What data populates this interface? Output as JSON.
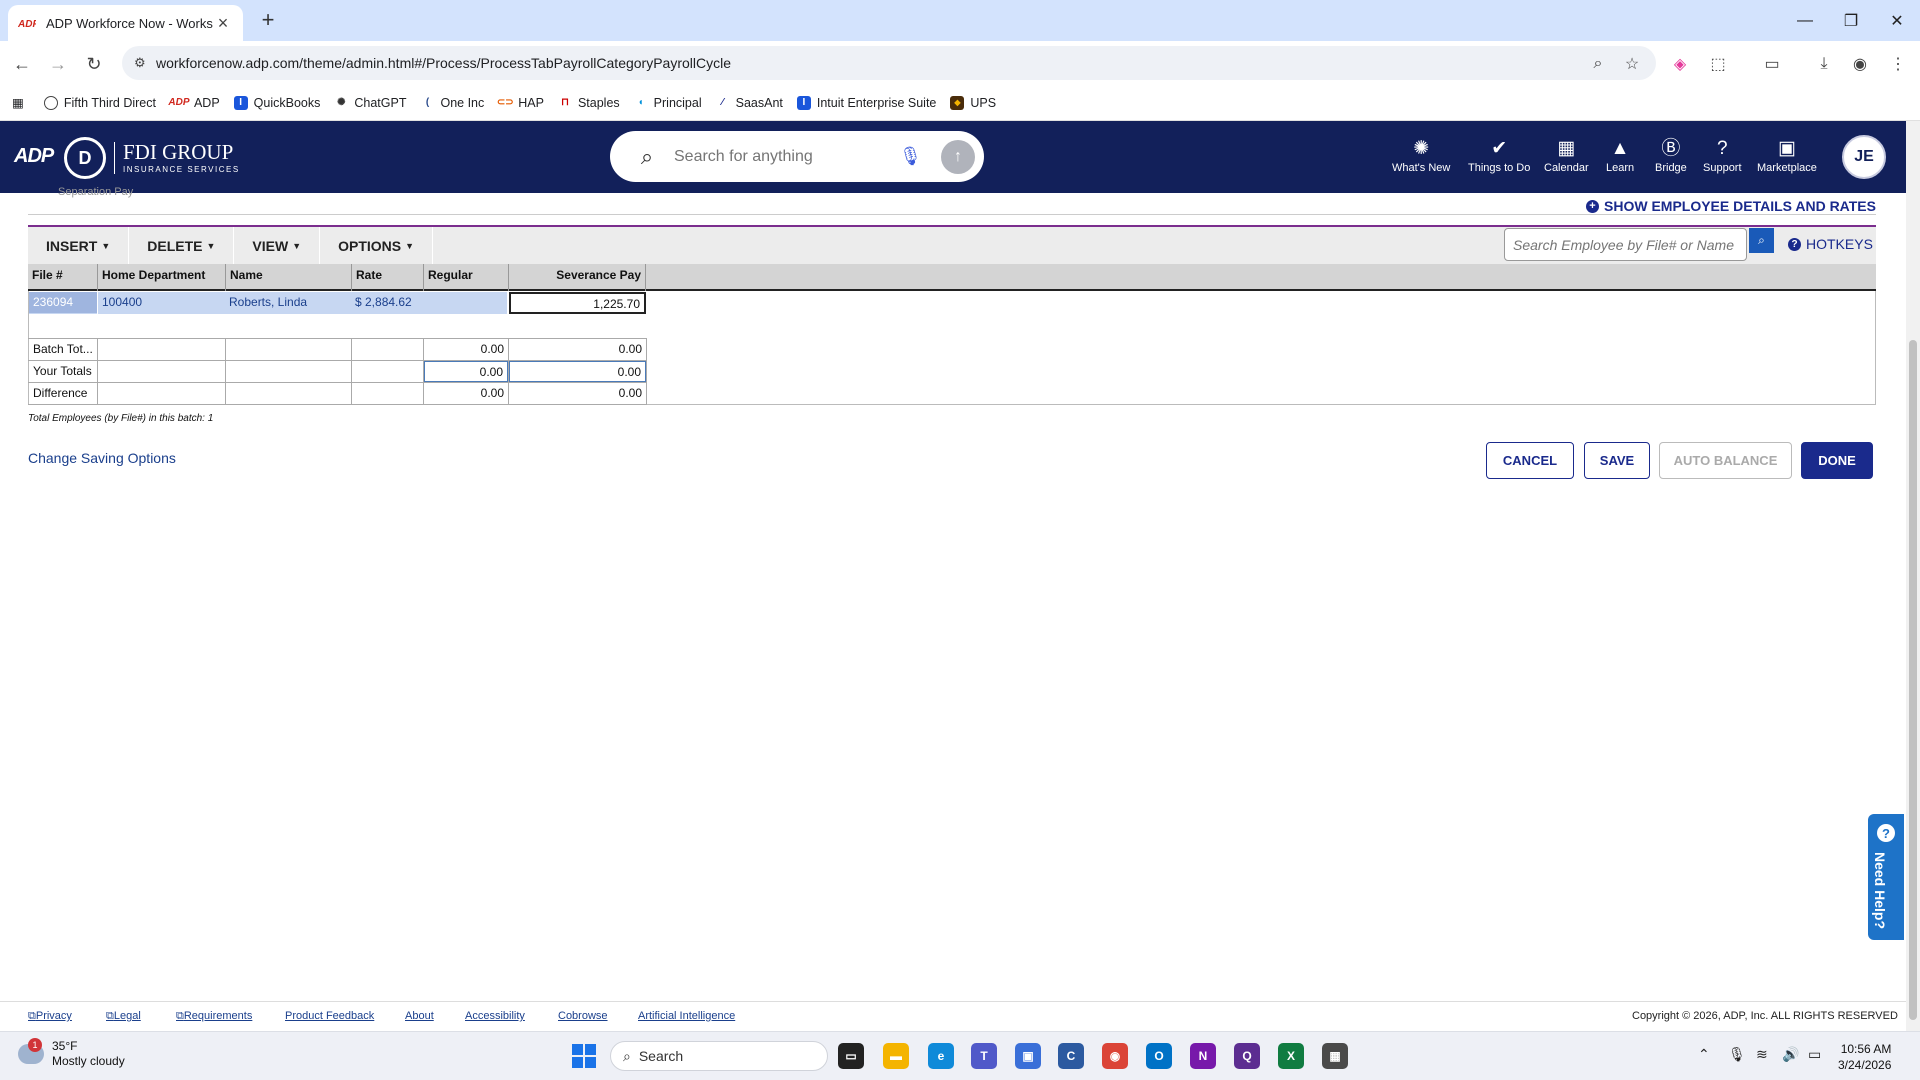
{
  "browser": {
    "tab_title": "ADP Workforce Now - Workshe",
    "url": "workforcenow.adp.com/theme/admin.html#/Process/ProcessTabPayrollCategoryPayrollCycle",
    "bookmarks": [
      "Fifth Third Direct",
      "ADP",
      "QuickBooks",
      "ChatGPT",
      "One Inc",
      "HAP",
      "Staples",
      "Principal",
      "SaasAnt",
      "Intuit Enterprise Suite",
      "UPS"
    ]
  },
  "header": {
    "adp_logo": "ADP",
    "brand_name": "FDI GROUP",
    "brand_sub": "INSURANCE SERVICES",
    "search_placeholder": "Search for anything",
    "nav": [
      {
        "label": "What's New",
        "icon": "lightbulb-icon"
      },
      {
        "label": "Things to Do",
        "icon": "check-circle-icon"
      },
      {
        "label": "Calendar",
        "icon": "calendar-icon"
      },
      {
        "label": "Learn",
        "icon": "graduation-cap-icon"
      },
      {
        "label": "Bridge",
        "icon": "bridge-icon"
      },
      {
        "label": "Support",
        "icon": "question-icon"
      },
      {
        "label": "Marketplace",
        "icon": "bag-icon"
      }
    ],
    "avatar_initials": "JE"
  },
  "page": {
    "partial_text": "Separation Pay",
    "show_details": "SHOW EMPLOYEE DETAILS AND RATES",
    "menus": [
      "INSERT",
      "DELETE",
      "VIEW",
      "OPTIONS"
    ],
    "employee_search_placeholder": "Search Employee by File# or Name",
    "hotkeys": "HOTKEYS",
    "columns": [
      "File #",
      "Home Department",
      "Name",
      "Rate",
      "Regular Hours",
      "Severance Pay"
    ],
    "row": {
      "file": "236094",
      "dept": "100400",
      "name": "Roberts, Linda",
      "rate": "$ 2,884.62",
      "hours": "",
      "severance": "1,225.70"
    },
    "totals": [
      {
        "label": "Batch Tot...",
        "hours": "0.00",
        "severance": "0.00"
      },
      {
        "label": "Your Totals",
        "hours": "0.00",
        "severance": "0.00"
      },
      {
        "label": "Difference",
        "hours": "0.00",
        "severance": "0.00"
      }
    ],
    "footnote": "Total Employees (by File#) in this batch: 1",
    "change_saving": "Change Saving Options",
    "buttons": {
      "cancel": "CANCEL",
      "save": "SAVE",
      "auto_balance": "AUTO BALANCE",
      "done": "DONE"
    },
    "need_help": "Need Help?"
  },
  "footer": {
    "links": [
      "Privacy",
      "Legal",
      "Requirements",
      "Product Feedback",
      "About",
      "Accessibility",
      "Cobrowse",
      "Artificial Intelligence"
    ],
    "copyright": "Copyright © 2026, ADP, Inc. ALL RIGHTS RESERVED"
  },
  "taskbar": {
    "temp": "35°F",
    "weather": "Mostly cloudy",
    "weather_badge": "1",
    "search": "Search",
    "time": "10:56 AM",
    "date": "3/24/2026"
  }
}
